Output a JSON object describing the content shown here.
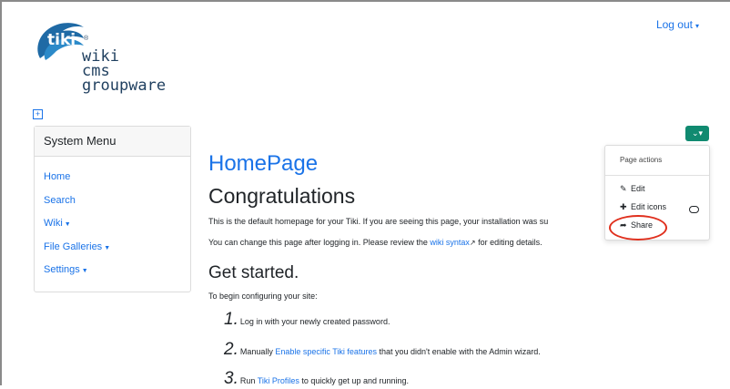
{
  "header": {
    "logo_badge": "tiki",
    "logo_text_line1": "wiki",
    "logo_text_line2": "cms",
    "logo_text_line3": "groupware",
    "logout_label": "Log out"
  },
  "sidebar": {
    "title": "System Menu",
    "items": [
      {
        "label": "Home",
        "has_caret": false
      },
      {
        "label": "Search",
        "has_caret": false
      },
      {
        "label": "Wiki",
        "has_caret": true
      },
      {
        "label": "File Galleries",
        "has_caret": true
      },
      {
        "label": "Settings",
        "has_caret": true
      }
    ]
  },
  "main": {
    "page_title": "HomePage",
    "heading1": "Congratulations",
    "para1": "This is the default homepage for your Tiki. If you are seeing this page, your installation was su",
    "para2_prefix": "You can change this page after logging in. Please review the ",
    "para2_link": "wiki syntax",
    "para2_suffix": " for editing details.",
    "heading2": "Get started.",
    "para3": "To begin configuring your site:",
    "steps": [
      {
        "num": "1.",
        "prefix": "Log in with your newly created password.",
        "link": "",
        "suffix": ""
      },
      {
        "num": "2.",
        "prefix": "Manually ",
        "link": "Enable specific Tiki features",
        "suffix": " that you didn't enable with the Admin wizard."
      },
      {
        "num": "3.",
        "prefix": "Run ",
        "link": "Tiki Profiles",
        "suffix": " to quickly get up and running."
      }
    ]
  },
  "page_actions": {
    "header": "Page actions",
    "items": [
      {
        "label": "Edit",
        "icon": "edit-icon"
      },
      {
        "label": "Edit icons",
        "icon": "puzzle-icon"
      },
      {
        "label": "Share",
        "icon": "share-icon"
      }
    ]
  },
  "colors": {
    "accent": "#1a73e8",
    "button_green": "#108a70",
    "highlight_red": "#e0301e"
  }
}
